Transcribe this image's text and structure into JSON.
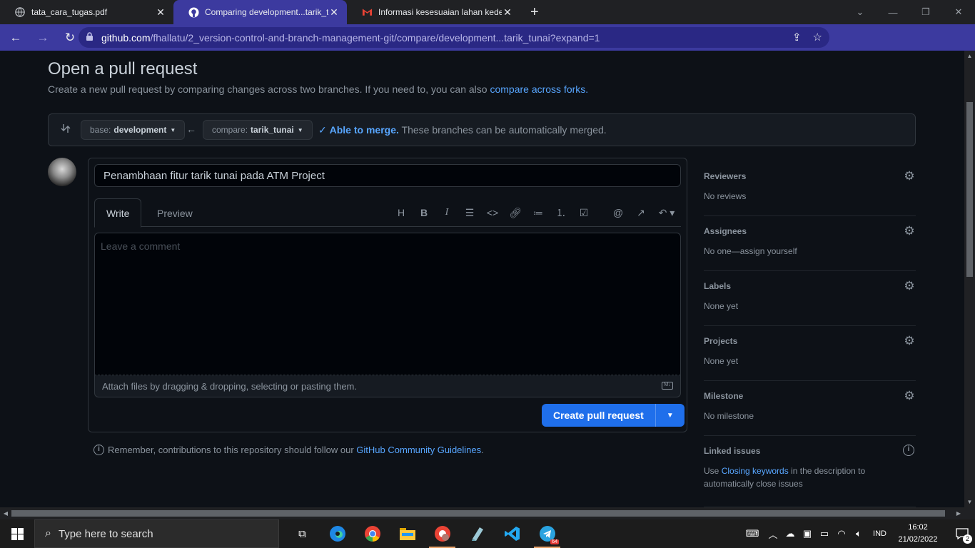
{
  "browser": {
    "tabs": [
      {
        "title": "tata_cara_tugas.pdf",
        "icon": "globe-icon"
      },
      {
        "title": "Comparing development...tarik_tunai",
        "icon": "github-icon"
      },
      {
        "title": "Informasi kesesuaian lahan kedelai",
        "icon": "gmail-icon"
      }
    ],
    "url_host": "github.com",
    "url_path": "/fhallatu/2_version-control-and-branch-management-git/compare/development...tarik_tunai?expand=1"
  },
  "header": {
    "title": "Open a pull request",
    "subtitle": "Create a new pull request by comparing changes across two branches. If you need to, you can also",
    "subtitle_link": "compare across forks."
  },
  "range": {
    "base_prefix": "base:",
    "base_branch": "development",
    "compare_prefix": "compare:",
    "compare_branch": "tarik_tunai",
    "merge_status": "Able to merge.",
    "merge_message": "These branches can be automatically merged."
  },
  "composer": {
    "title_value": "Penambhaan fitur tarik tunai pada ATM Project",
    "tab_write": "Write",
    "tab_preview": "Preview",
    "comment_placeholder": "Leave a comment",
    "attach_text": "Attach files by dragging & dropping, selecting or pasting them.",
    "create_button": "Create pull request"
  },
  "note": {
    "text": "Remember, contributions to this repository should follow our",
    "link": "GitHub Community Guidelines",
    "end": "."
  },
  "sidebar": {
    "reviewers": {
      "label": "Reviewers",
      "value": "No reviews"
    },
    "assignees": {
      "label": "Assignees",
      "value": "No one—assign yourself"
    },
    "labels": {
      "label": "Labels",
      "value": "None yet"
    },
    "projects": {
      "label": "Projects",
      "value": "None yet"
    },
    "milestone": {
      "label": "Milestone",
      "value": "No milestone"
    },
    "linked": {
      "label": "Linked issues",
      "value_pre": "Use",
      "value_link": "Closing keywords",
      "value_post": "in the description to automatically close issues"
    }
  },
  "taskbar": {
    "search_placeholder": "Type here to search",
    "language": "IND",
    "time": "16:02",
    "date": "21/02/2022",
    "notifications": "2",
    "telegram_badge": "64"
  }
}
